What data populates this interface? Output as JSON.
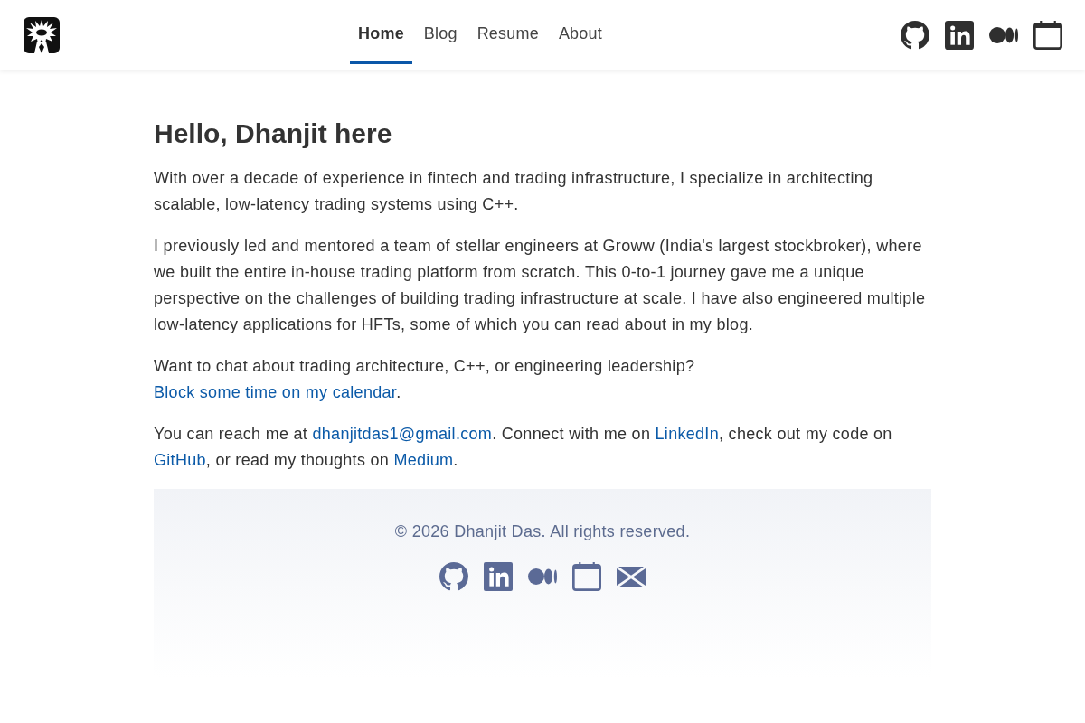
{
  "header": {
    "nav": [
      {
        "label": "Home",
        "selected": true
      },
      {
        "label": "Blog",
        "selected": false
      },
      {
        "label": "Resume",
        "selected": false
      },
      {
        "label": "About",
        "selected": false
      }
    ]
  },
  "main": {
    "heading": "Hello, Dhanjit here",
    "paragraphs": [
      [
        {
          "kind": "text",
          "text": "With over a decade of experience in fintech and trading infrastructure, I specialize in architecting scalable, low-latency trading systems using C++."
        }
      ],
      [
        {
          "kind": "text",
          "text": "I previously led and mentored a team of stellar engineers at Groww (India's largest stockbroker), where we built the entire in-house trading platform from scratch. This 0-to-1 journey gave me a unique perspective on the challenges of building trading infrastructure at scale. I have also engineered multiple low-latency applications for HFTs, some of which you can read about in my blog."
        }
      ],
      [
        {
          "kind": "text",
          "text": "Want to chat about trading architecture, C++, or engineering leadership? "
        },
        {
          "kind": "link",
          "text": "Block some time on my calendar"
        },
        {
          "kind": "text",
          "text": "."
        }
      ],
      [
        {
          "kind": "text",
          "text": "You can reach me at "
        },
        {
          "kind": "link",
          "text": "dhanjitdas1@gmail.com"
        },
        {
          "kind": "text",
          "text": ". Connect with me on "
        },
        {
          "kind": "link",
          "text": "LinkedIn"
        },
        {
          "kind": "text",
          "text": ", check out my code on "
        },
        {
          "kind": "link",
          "text": "GitHub"
        },
        {
          "kind": "text",
          "text": ", or read my thoughts on "
        },
        {
          "kind": "link",
          "text": "Medium"
        },
        {
          "kind": "text",
          "text": "."
        }
      ]
    ]
  },
  "footer": {
    "copyright": "© 2026 Dhanjit Das. All rights reserved."
  }
}
